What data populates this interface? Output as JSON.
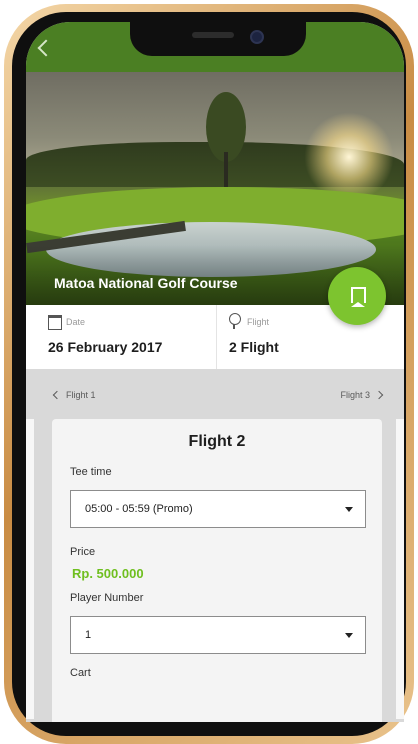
{
  "hero": {
    "course_name": "Matoa National Golf Course"
  },
  "info": {
    "date_label": "Date",
    "date_value": "26 February 2017",
    "flight_label": "Flight",
    "flight_value": "2 Flight"
  },
  "flight_nav": {
    "prev_label": "Flight 1",
    "next_label": "Flight 3"
  },
  "card": {
    "title": "Flight 2",
    "tee_time_label": "Tee time",
    "tee_time_value": "05:00 - 05:59 (Promo)",
    "price_label": "Price",
    "price_value": "Rp. 500.000",
    "player_label": "Player Number",
    "player_value": "1",
    "cart_label": "Cart"
  },
  "colors": {
    "appbar": "#4b7f23",
    "accent": "#7dc42f",
    "price": "#6fbf1f"
  },
  "icons": [
    "back-icon",
    "bookmark-icon",
    "calendar-icon",
    "golf-ball-icon",
    "chevron-left-icon",
    "chevron-right-icon",
    "caret-down-icon"
  ]
}
